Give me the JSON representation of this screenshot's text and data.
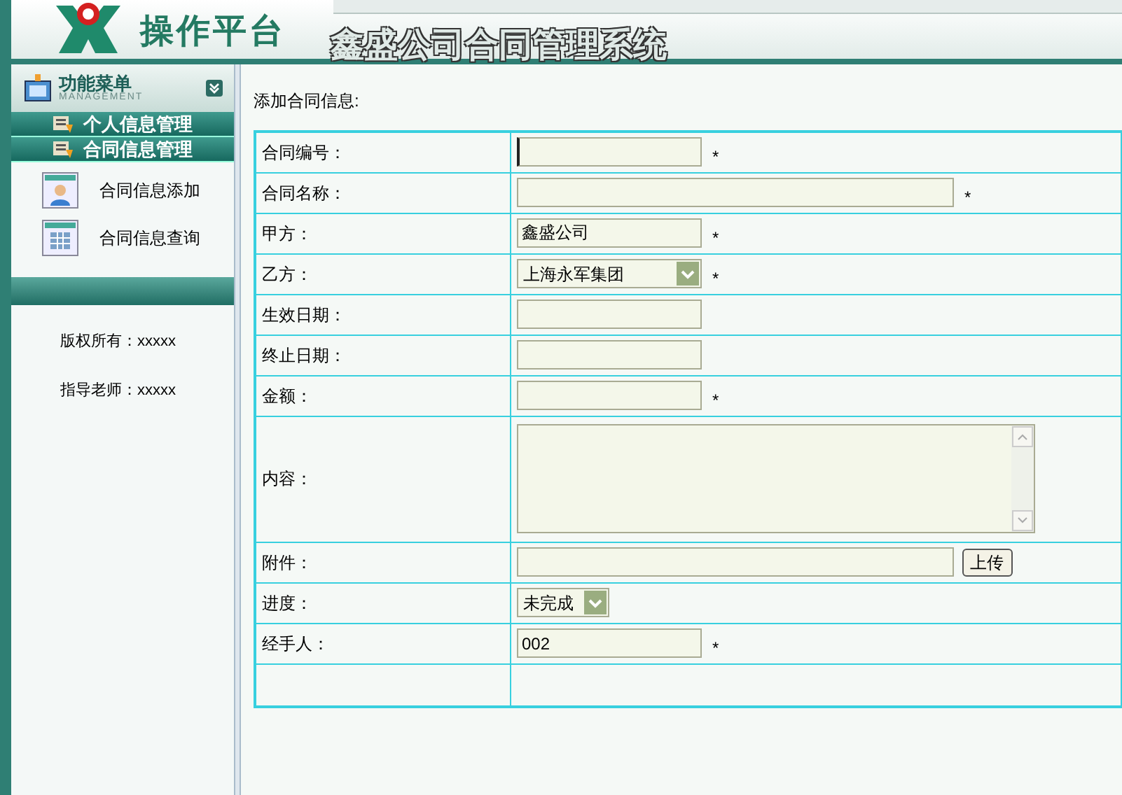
{
  "header": {
    "platform_title": "操作平台",
    "system_title": "鑫盛公司合同管理系统"
  },
  "sidebar": {
    "menu_title": "功能菜单",
    "menu_subtitle": "MANAGEMENT",
    "groups": [
      {
        "label": "个人信息管理"
      },
      {
        "label": "合同信息管理",
        "items": [
          {
            "label": "合同信息添加"
          },
          {
            "label": "合同信息查询"
          }
        ]
      }
    ],
    "footer": [
      "版权所有：xxxxx",
      "指导老师：xxxxx"
    ]
  },
  "form": {
    "title": "添加合同信息:",
    "rows": [
      {
        "label": "合同编号：",
        "kind": "text",
        "value": "",
        "mark": "*",
        "focused": true
      },
      {
        "label": "合同名称：",
        "kind": "wide",
        "value": "",
        "mark": "*",
        "focused": false
      },
      {
        "label": "甲方：",
        "kind": "text",
        "value": "鑫盛公司",
        "mark": "*",
        "focused": false
      },
      {
        "label": "乙方：",
        "kind": "select",
        "value": "上海永军集团",
        "mark": "*"
      },
      {
        "label": "生效日期：",
        "kind": "text",
        "value": "",
        "focused": false
      },
      {
        "label": "终止日期：",
        "kind": "text",
        "value": "",
        "focused": false
      },
      {
        "label": "金额：",
        "kind": "text",
        "value": "",
        "mark": "*",
        "focused": false
      },
      {
        "label": "内容：",
        "kind": "textarea",
        "value": ""
      },
      {
        "label": "附件：",
        "kind": "file",
        "value": "",
        "button": "上传"
      },
      {
        "label": "进度：",
        "kind": "status",
        "value": "未完成"
      },
      {
        "label": "经手人：",
        "kind": "text",
        "value": "002",
        "mark": "*",
        "focused": false
      },
      {
        "kind": "empty"
      }
    ]
  }
}
